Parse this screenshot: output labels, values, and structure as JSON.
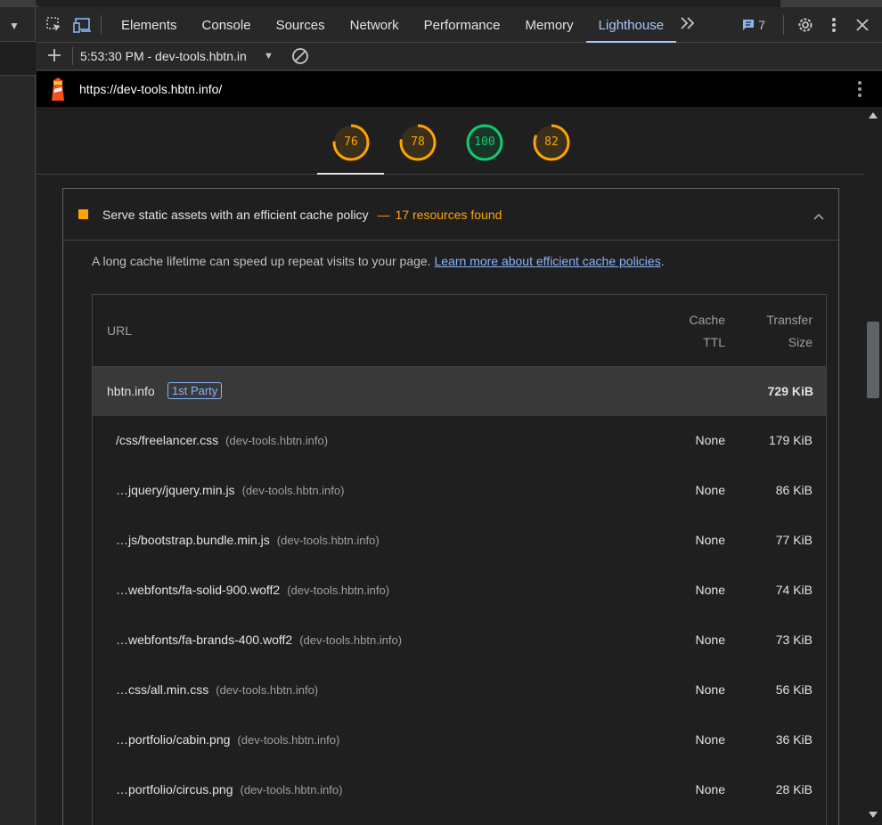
{
  "devtools": {
    "tabs": [
      "Elements",
      "Console",
      "Sources",
      "Network",
      "Performance",
      "Memory",
      "Lighthouse"
    ],
    "active_tab": "Lighthouse",
    "more_tabs_icon": "chevron-double-right-icon",
    "issues_count": "7",
    "icons": {
      "inspect": "inspect-element-icon",
      "device": "device-toolbar-icon",
      "settings": "gear-icon",
      "menu": "kebab-menu-icon",
      "close": "close-icon"
    }
  },
  "lighthouse": {
    "new_report_icon": "plus-icon",
    "report_select": "5:53:30 PM - dev-tools.hbtn.in",
    "clear_icon": "clear-icon",
    "url": "https://dev-tools.hbtn.info/",
    "scores": [
      {
        "value": "76",
        "fraction": 0.76,
        "color": "#ffa400"
      },
      {
        "value": "78",
        "fraction": 0.78,
        "color": "#ffa400"
      },
      {
        "value": "100",
        "fraction": 1.0,
        "color": "#0cce6b"
      },
      {
        "value": "82",
        "fraction": 0.82,
        "color": "#ffa400"
      }
    ]
  },
  "audit": {
    "title": "Serve static assets with an efficient cache policy",
    "dash": "—",
    "found": "17 resources found",
    "status_color": "#ffa400",
    "description": "A long cache lifetime can speed up repeat visits to your page.",
    "link_text": "Learn more about efficient cache policies",
    "after_link": ".",
    "table": {
      "headers": {
        "url": "URL",
        "cache_ttl_1": "Cache",
        "cache_ttl_2": "TTL",
        "size_1": "Transfer",
        "size_2": "Size"
      },
      "group": {
        "name": "hbtn.info",
        "badge": "1st Party",
        "size": "729 KiB"
      },
      "rows": [
        {
          "url": "/css/freelancer.css",
          "host": "(dev-tools.hbtn.info)",
          "ttl": "None",
          "size": "179 KiB"
        },
        {
          "url": "…jquery/jquery.min.js",
          "host": "(dev-tools.hbtn.info)",
          "ttl": "None",
          "size": "86 KiB"
        },
        {
          "url": "…js/bootstrap.bundle.min.js",
          "host": "(dev-tools.hbtn.info)",
          "ttl": "None",
          "size": "77 KiB"
        },
        {
          "url": "…webfonts/fa-solid-900.woff2",
          "host": "(dev-tools.hbtn.info)",
          "ttl": "None",
          "size": "74 KiB"
        },
        {
          "url": "…webfonts/fa-brands-400.woff2",
          "host": "(dev-tools.hbtn.info)",
          "ttl": "None",
          "size": "73 KiB"
        },
        {
          "url": "…css/all.min.css",
          "host": "(dev-tools.hbtn.info)",
          "ttl": "None",
          "size": "56 KiB"
        },
        {
          "url": "…portfolio/cabin.png",
          "host": "(dev-tools.hbtn.info)",
          "ttl": "None",
          "size": "36 KiB"
        },
        {
          "url": "…portfolio/circus.png",
          "host": "(dev-tools.hbtn.info)",
          "ttl": "None",
          "size": "28 KiB"
        }
      ]
    }
  }
}
